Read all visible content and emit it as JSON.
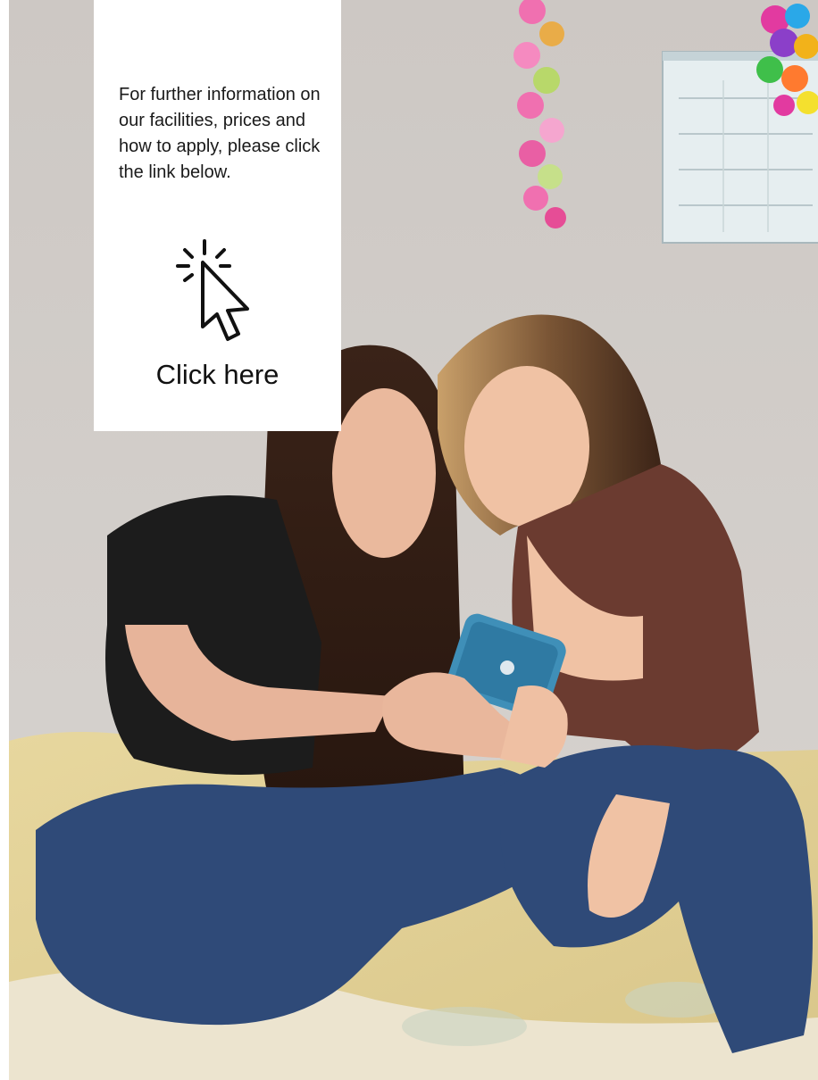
{
  "card": {
    "info_text": "For further information on our facilities, prices and how to apply, please click the link below.",
    "link_label": "Click here",
    "icon": "pointer-click-icon"
  },
  "photo": {
    "description_icon": "students-photo"
  },
  "colors": {
    "card_bg": "#ffffff",
    "text": "#1a1a1a",
    "wall": "#d6d2ce",
    "bedding": "#e8d8a0",
    "jeans": "#2f4a78",
    "top_brown": "#6b3b30",
    "top_black": "#1c1c1c"
  }
}
